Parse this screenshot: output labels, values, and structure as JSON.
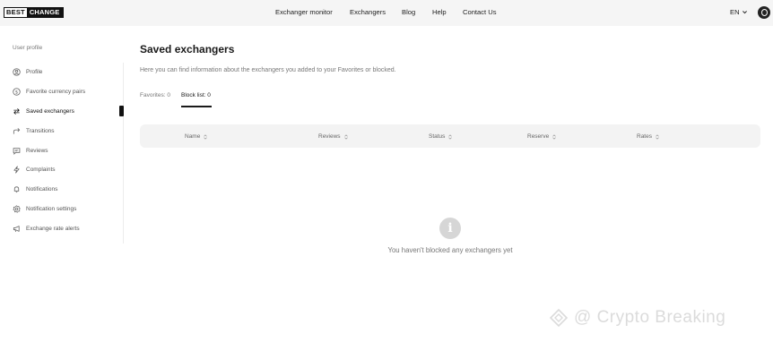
{
  "header": {
    "logo": {
      "part1": "BEST",
      "part2": "CHANGE"
    },
    "nav": [
      "Exchanger monitor",
      "Exchangers",
      "Blog",
      "Help",
      "Contact Us"
    ],
    "language": "EN"
  },
  "sidebar": {
    "title": "User profile",
    "items": [
      {
        "label": "Profile",
        "icon": "user-circle-icon"
      },
      {
        "label": "Favorite currency pairs",
        "icon": "dollar-circle-icon"
      },
      {
        "label": "Saved exchangers",
        "icon": "swap-arrows-icon",
        "active": true
      },
      {
        "label": "Transitions",
        "icon": "share-arrow-icon"
      },
      {
        "label": "Reviews",
        "icon": "chat-bubble-icon"
      },
      {
        "label": "Complaints",
        "icon": "lightning-icon"
      },
      {
        "label": "Notifications",
        "icon": "bell-icon"
      },
      {
        "label": "Notification settings",
        "icon": "gear-icon"
      },
      {
        "label": "Exchange rate alerts",
        "icon": "megaphone-icon"
      }
    ]
  },
  "main": {
    "title": "Saved exchangers",
    "subtitle": "Here you can find information about the exchangers you added to your Favorites or blocked.",
    "tabs": [
      "Favorites: 0",
      "Block list: 0"
    ],
    "active_tab": "Block list: 0",
    "columns": [
      "Name",
      "Reviews",
      "Status",
      "Reserve",
      "Rates"
    ],
    "empty_message": "You haven't blocked any exchangers yet"
  },
  "watermark": {
    "text": "@ Crypto Breaking"
  },
  "colors": {
    "active": "#111111",
    "muted": "#777777",
    "header_bg": "#f5f5f5",
    "table_head_bg": "#f3f3f3"
  }
}
